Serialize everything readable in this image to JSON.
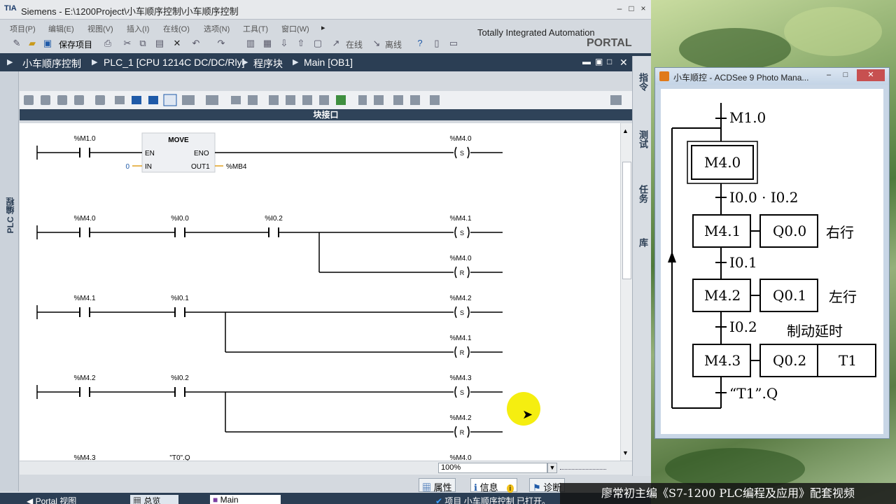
{
  "tia": {
    "window_title": "Siemens  -  E:\\1200Project\\小车顺序控制\\小车顺序控制",
    "logo": "TIA",
    "menu": [
      "项目(P)",
      "编辑(E)",
      "视图(V)",
      "插入(I)",
      "在线(O)",
      "选项(N)",
      "工具(T)",
      "窗口(W)"
    ],
    "toolbar": {
      "save_label": "保存项目",
      "online_label": "在线",
      "offline_label": "离线"
    },
    "brand_line1": "Totally Integrated Automation",
    "brand_line2": "PORTAL",
    "breadcrumb": [
      "小车顺序控制",
      "PLC_1 [CPU 1214C DC/DC/Rly]",
      "程序块",
      "Main [OB1]"
    ],
    "left_strip_label": "PLC 编程",
    "right_tabs": [
      "指令",
      "测试",
      "任务",
      "库"
    ],
    "interface_label": "块接口",
    "zoom": "100%",
    "inspector_tabs": [
      "属性",
      "信息",
      "诊断"
    ],
    "taskbar": {
      "portal_view": "Portal 视图",
      "overview": "总览",
      "main": "Main",
      "status": "项目 小车顺序控制 已打开。"
    }
  },
  "ladder": {
    "networks": [
      {
        "contacts": [
          {
            "label": "%M1.0"
          }
        ],
        "move": {
          "title": "MOVE",
          "en": "EN",
          "eno": "ENO",
          "in_label": "IN",
          "in_value": "0",
          "out_label": "OUT1",
          "out_value": "%MB4"
        },
        "coils": [
          {
            "label": "%M4.0",
            "type": "S"
          }
        ]
      },
      {
        "contacts": [
          {
            "label": "%M4.0"
          },
          {
            "label": "%I0.0"
          },
          {
            "label": "%I0.2"
          }
        ],
        "coils": [
          {
            "label": "%M4.1",
            "type": "S"
          },
          {
            "label": "%M4.0",
            "type": "R"
          }
        ]
      },
      {
        "contacts": [
          {
            "label": "%M4.1"
          },
          {
            "label": "%I0.1"
          }
        ],
        "coils": [
          {
            "label": "%M4.2",
            "type": "S"
          },
          {
            "label": "%M4.1",
            "type": "R"
          }
        ]
      },
      {
        "contacts": [
          {
            "label": "%M4.2"
          },
          {
            "label": "%I0.2"
          }
        ],
        "coils": [
          {
            "label": "%M4.3",
            "type": "S"
          },
          {
            "label": "%M4.2",
            "type": "R"
          }
        ]
      },
      {
        "contacts": [
          {
            "label": "%M4.3"
          },
          {
            "label": "\"T0\".Q"
          }
        ],
        "coils": [
          {
            "label": "%M4.0",
            "type": "S"
          }
        ]
      }
    ]
  },
  "acdsee": {
    "title": "小车顺控 - ACDSee 9 Photo Mana...",
    "sfc": {
      "initial_step": "M4.0",
      "entry": "M1.0",
      "transitions": [
        "I0.0 · I0.2",
        "I0.1",
        "I0.2",
        "“T1”.Q"
      ],
      "steps": [
        {
          "name": "M4.1",
          "action": "Q0.0",
          "note": "右行"
        },
        {
          "name": "M4.2",
          "action": "Q0.1",
          "note": "左行"
        },
        {
          "name": "M4.3",
          "action": "Q0.2",
          "action2": "T1",
          "note": "制动延时"
        }
      ]
    }
  },
  "caption": "廖常初主编《S7-1200 PLC编程及应用》配套视频"
}
